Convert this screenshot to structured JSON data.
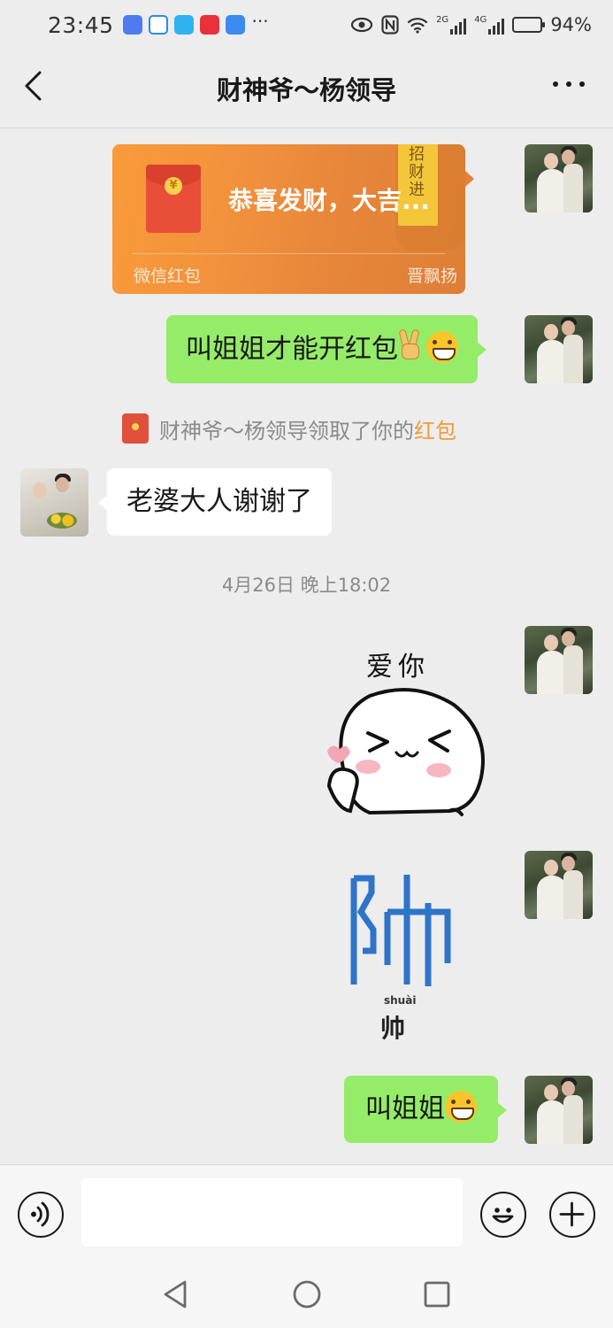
{
  "status_bar": {
    "time": "23:45",
    "more": "···",
    "network_2g": "2G",
    "network_4g": "4G",
    "battery_percent": "94%",
    "battery_level": 0.94
  },
  "header": {
    "title": "财神爷～杨领导"
  },
  "messages": {
    "red_packet": {
      "title": "恭喜发财，大吉...",
      "label": "微信红包",
      "sender_name": "晋飘扬",
      "banner_text": "招财进"
    },
    "msg1_text": "叫姐姐才能开红包",
    "system_notice": {
      "prefix": "财神爷～杨领导领取了你的",
      "link": "红包"
    },
    "msg2_text": "老婆大人谢谢了",
    "timestamp": "4月26日 晚上18:02",
    "sticker_love_text": "爱你",
    "sticker_shuai_pinyin": "shuài",
    "sticker_shuai_char": "帅",
    "msg3_text": "叫姐姐"
  },
  "colors": {
    "bubble_mine": "#95EC69",
    "bubble_theirs": "#FFFFFF",
    "background": "#EDEDED",
    "red_packet": "#F2913C",
    "link_orange": "#F09A3A",
    "shuai_blue": "#2E74C9"
  },
  "icons": {
    "back": "chevron-left-icon",
    "more": "more-dots-icon",
    "voice": "voice-icon",
    "emoji": "emoji-icon",
    "plus": "plus-icon",
    "nav_back": "nav-back-icon",
    "nav_home": "nav-home-icon",
    "nav_recent": "nav-recent-icon"
  },
  "input": {
    "placeholder": ""
  }
}
